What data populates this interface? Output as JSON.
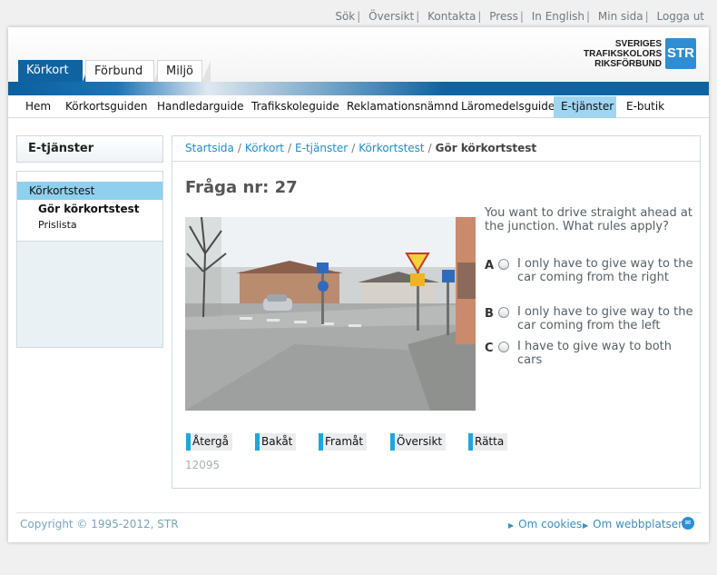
{
  "utility_nav": [
    "Sök",
    "Översikt",
    "Kontakta",
    "Press",
    "In English",
    "Min sida",
    "Logga ut"
  ],
  "utility_sep": "|",
  "top_tabs": [
    "Körkort",
    "Förbund",
    "Miljö"
  ],
  "logo": {
    "line1": "SVERIGES",
    "line2": "TRAFIKSKOLORS",
    "line3": "RIKSFÖRBUND",
    "mark": "STR"
  },
  "main_nav": [
    "Hem",
    "Körkortsguiden",
    "Handledarguide",
    "Trafikskoleguide",
    "Reklamationsnämnd",
    "Läromedelsguide",
    "E-tjänster",
    "E-butik"
  ],
  "sidebar": {
    "title": "E-tjänster",
    "active_item": "Körkortstest",
    "sub_items": [
      "Gör körkortstest",
      "Prislista"
    ]
  },
  "breadcrumb": {
    "items": [
      "Startsida",
      "Körkort",
      "E-tjänster",
      "Körkortstest"
    ],
    "current": "Gör körkortstest",
    "sep": "/"
  },
  "question": {
    "title": "Fråga nr: 27",
    "text": "You want to drive straight ahead at the junction. What rules apply?",
    "answers": [
      {
        "letter": "A",
        "text": "I only have to give way to the car coming from the right"
      },
      {
        "letter": "B",
        "text": "I only have to give way to the car coming from the left"
      },
      {
        "letter": "C",
        "text": "I have to give way to both cars"
      }
    ]
  },
  "buttons": [
    "Återgå",
    "Bakåt",
    "Framåt",
    "Översikt",
    "Rätta"
  ],
  "question_id": "12095",
  "footer": {
    "copyright": "Copyright © 1995-2012, STR",
    "links": [
      "Om cookies",
      "Om webbplatsen"
    ]
  },
  "colors": {
    "brand_blue": "#0f63a1",
    "accent_cyan": "#1fa6df",
    "link": "#1c8fc8"
  },
  "icons": {
    "footer": "share-icon",
    "answer_input": "radio-button"
  }
}
